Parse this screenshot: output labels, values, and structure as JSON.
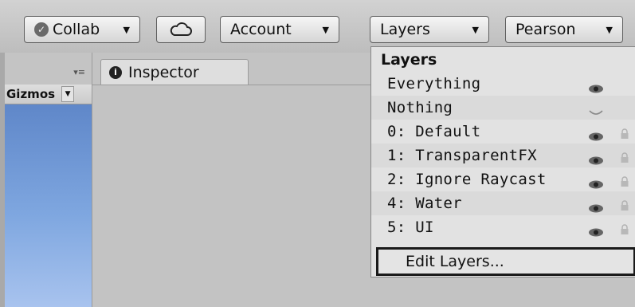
{
  "toolbar": {
    "collab_label": "Collab",
    "account_label": "Account",
    "layers_label": "Layers",
    "layout_label": "Pearson",
    "dropdown_arrow": "▼"
  },
  "icons": {
    "collab": "check-circle-icon",
    "cloud": "cloud-icon",
    "inspector": "info-icon",
    "visible": "eye-icon",
    "hidden": "eye-closed-icon",
    "locked": "lock-icon"
  },
  "scene": {
    "gizmos_label": "Gizmos"
  },
  "inspector": {
    "tab_label": "Inspector"
  },
  "layers_menu": {
    "title": "Layers",
    "items": [
      {
        "label": "Everything",
        "visible": true,
        "lock": false
      },
      {
        "label": "Nothing",
        "visible": false,
        "lock": false
      },
      {
        "label": "0: Default",
        "visible": true,
        "lock": true
      },
      {
        "label": "1: TransparentFX",
        "visible": true,
        "lock": true
      },
      {
        "label": "2: Ignore Raycast",
        "visible": true,
        "lock": true
      },
      {
        "label": "4: Water",
        "visible": true,
        "lock": true
      },
      {
        "label": "5: UI",
        "visible": true,
        "lock": true
      }
    ],
    "edit_label": "Edit Layers..."
  }
}
